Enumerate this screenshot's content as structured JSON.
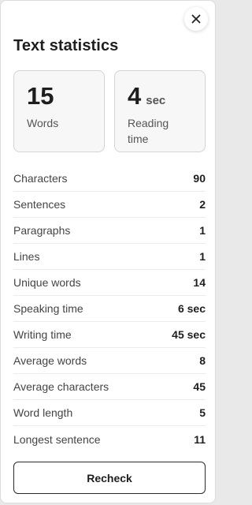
{
  "panel": {
    "title": "Text statistics",
    "close_icon": "close-icon"
  },
  "cards": {
    "words": {
      "value": "15",
      "label": "Words"
    },
    "reading_time": {
      "value": "4",
      "unit": "sec",
      "label": "Reading time"
    }
  },
  "stats": [
    {
      "label": "Characters",
      "value": "90"
    },
    {
      "label": "Sentences",
      "value": "2"
    },
    {
      "label": "Paragraphs",
      "value": "1"
    },
    {
      "label": "Lines",
      "value": "1"
    },
    {
      "label": "Unique words",
      "value": "14"
    },
    {
      "label": "Speaking time",
      "value": "6 sec"
    },
    {
      "label": "Writing time",
      "value": "45 sec"
    },
    {
      "label": "Average words",
      "value": "8"
    },
    {
      "label": "Average characters",
      "value": "45"
    },
    {
      "label": "Word length",
      "value": "5"
    },
    {
      "label": "Longest sentence",
      "value": "11"
    }
  ],
  "actions": {
    "recheck_label": "Recheck"
  }
}
